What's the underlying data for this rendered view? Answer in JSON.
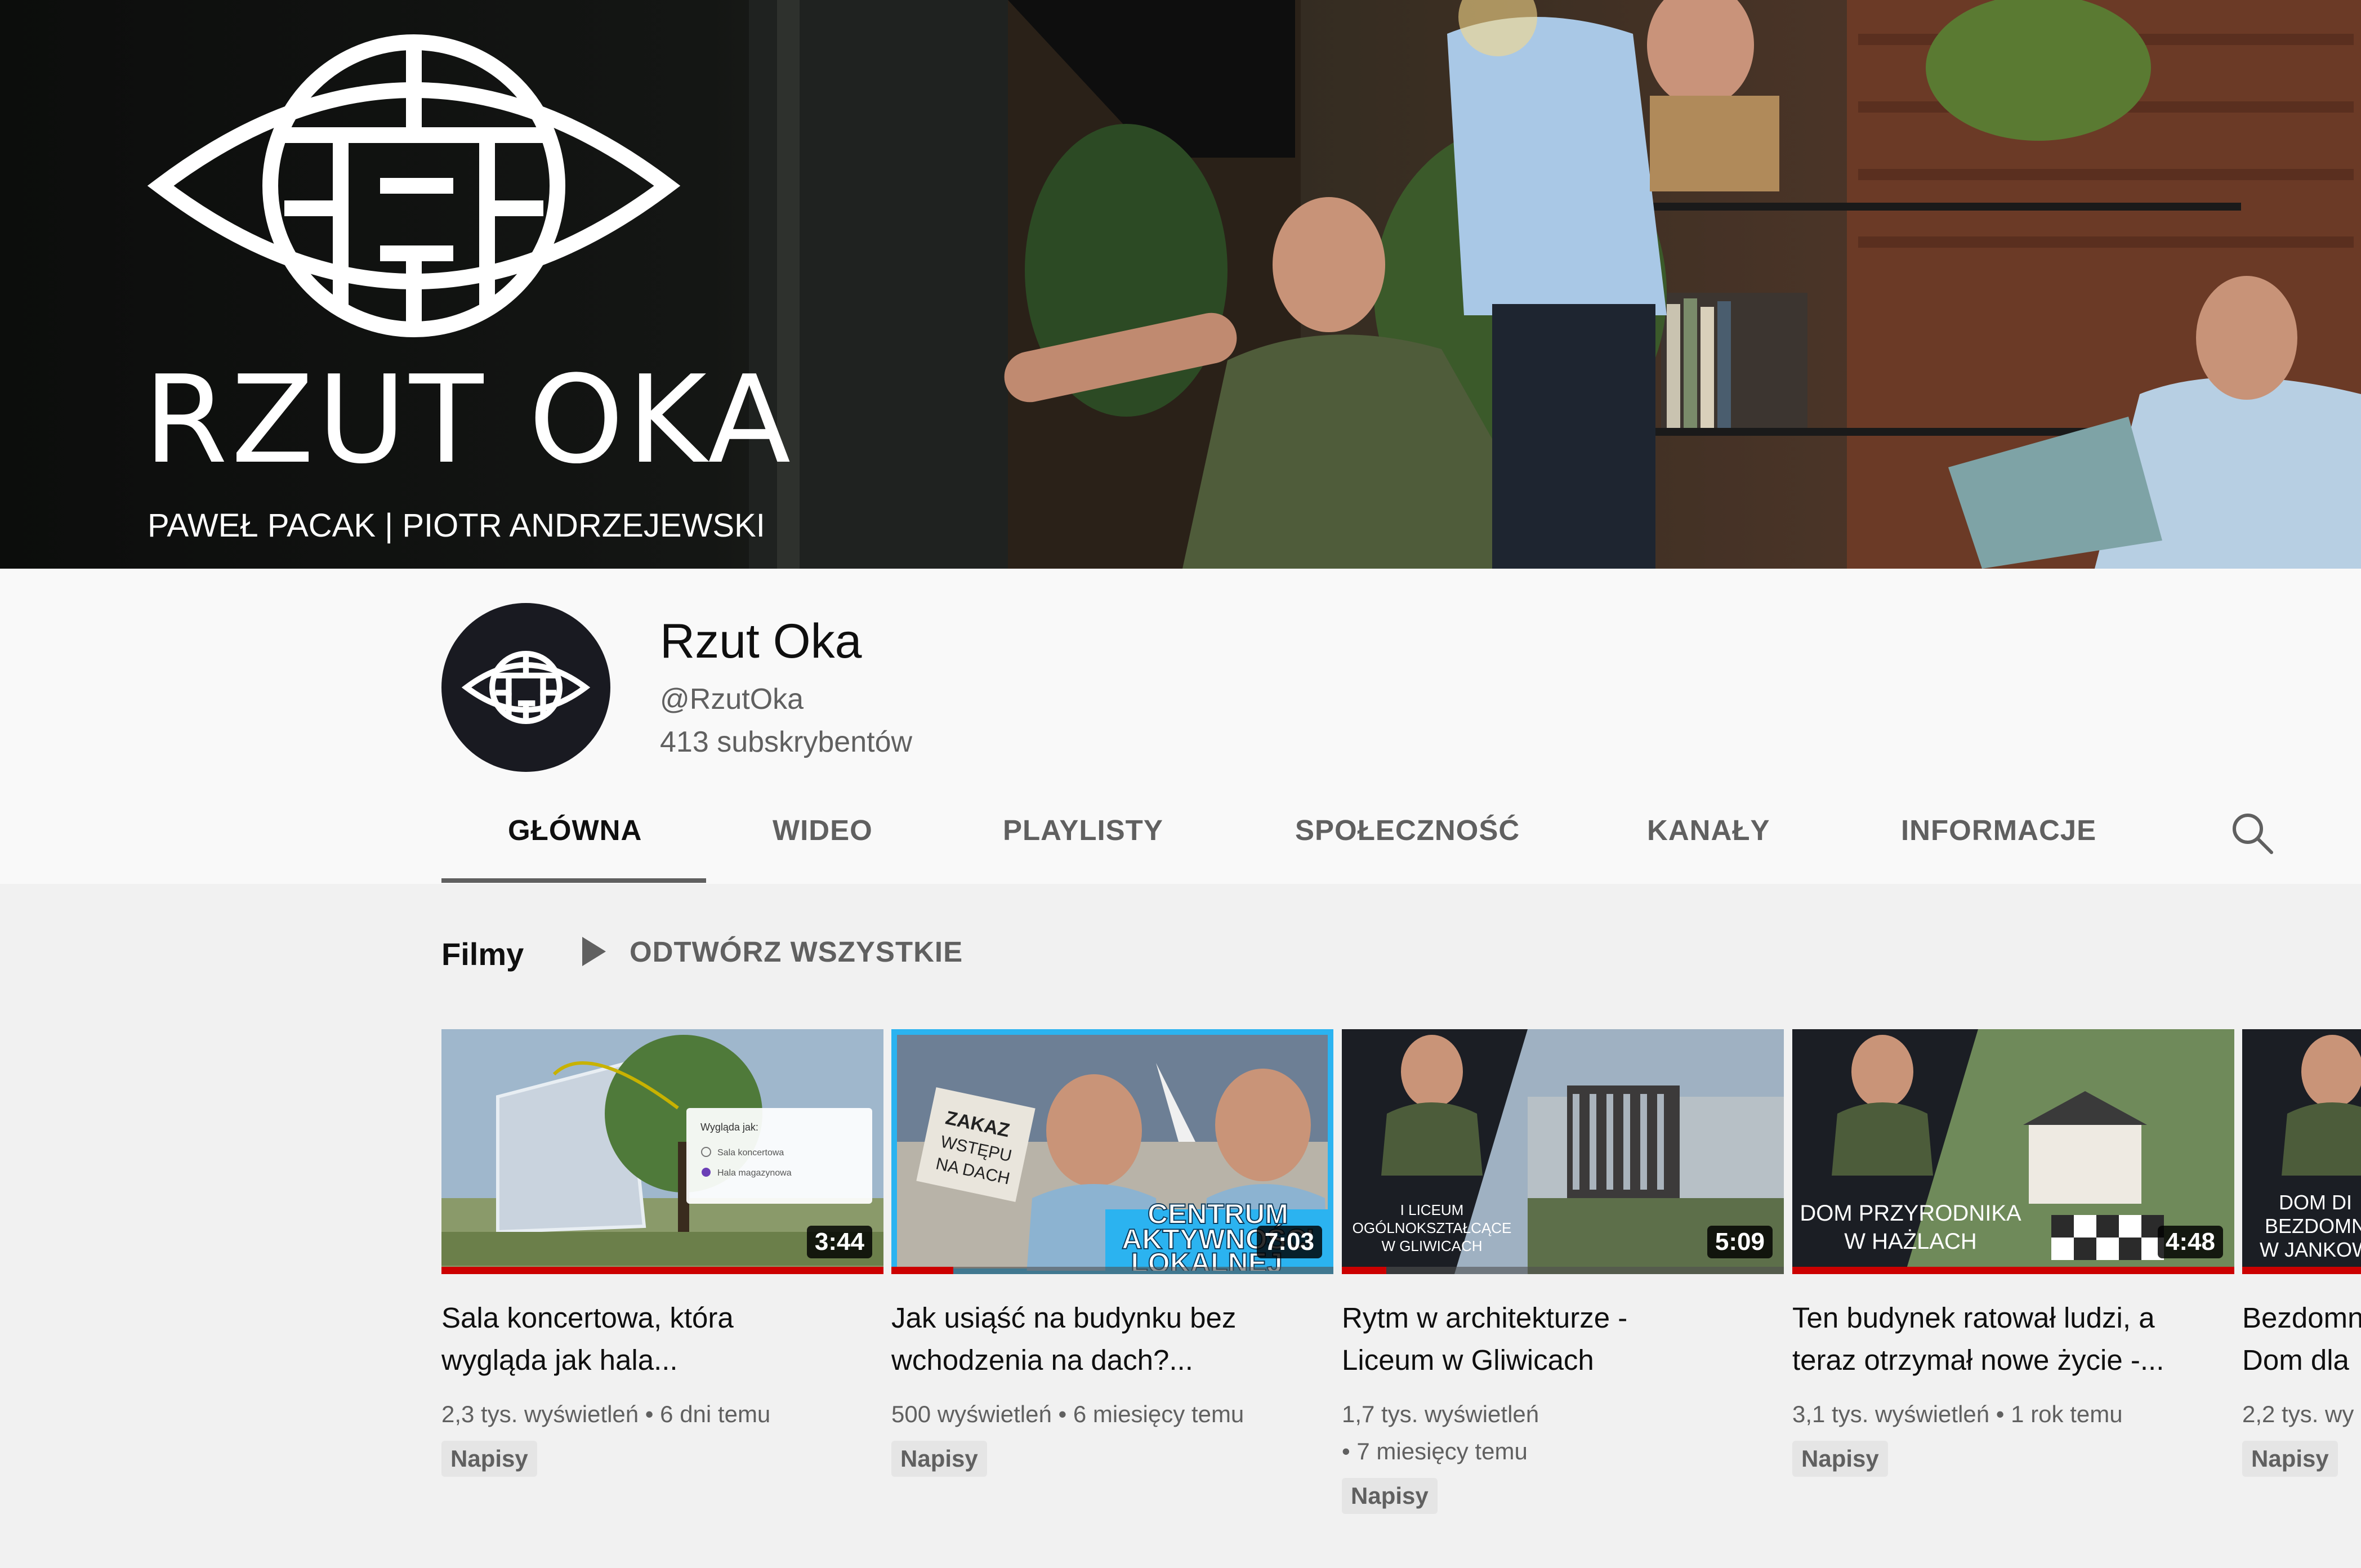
{
  "banner": {
    "title": "RZUT OKA",
    "subtitle": "PAWEŁ PACAK | PIOTR ANDRZEJEWSKI",
    "logo_icon": "eye-maze-icon"
  },
  "channel": {
    "name": "Rzut Oka",
    "handle": "@RzutOka",
    "subscribers": "413 subskrybentów",
    "avatar_icon": "eye-maze-icon"
  },
  "tabs": [
    {
      "label": "GŁÓWNA",
      "active": true
    },
    {
      "label": "WIDEO",
      "active": false
    },
    {
      "label": "PLAYLISTY",
      "active": false
    },
    {
      "label": "SPOŁECZNOŚĆ",
      "active": false
    },
    {
      "label": "KANAŁY",
      "active": false
    },
    {
      "label": "INFORMACJE",
      "active": false
    }
  ],
  "search_icon": "search-icon",
  "section": {
    "title": "Filmy",
    "play_all": "ODTWÓRZ WSZYSTKIE",
    "play_icon": "play-icon"
  },
  "videos": [
    {
      "title_line1": "Sala koncertowa, która",
      "title_line2": "wygląda jak hala...",
      "meta_line1": "2,3 tys. wyświetleń • 6 dni temu",
      "meta_line2": "",
      "duration": "3:44",
      "badge": "Napisy",
      "progress": 1.0,
      "thumb_text": [
        "Wygląda jak:",
        "Sala koncertowa",
        "Hala magazynowa"
      ]
    },
    {
      "title_line1": "Jak usiąść na budynku bez",
      "title_line2": "wchodzenia na dach?...",
      "meta_line1": "500 wyświetleń • 6 miesięcy temu",
      "meta_line2": "",
      "duration": "7:03",
      "badge": "Napisy",
      "progress": 0.14,
      "thumb_text": [
        "ZAKAZ",
        "WSTĘPU",
        "NA DACH",
        "CENTRUM",
        "AKTYWNOŚCI",
        "LOKALNEJ"
      ]
    },
    {
      "title_line1": "Rytm w architekturze -",
      "title_line2": "Liceum w Gliwicach",
      "meta_line1": "1,7 tys. wyświetleń",
      "meta_line2": "• 7 miesięcy temu",
      "duration": "5:09",
      "badge": "Napisy",
      "progress": 0.1,
      "thumb_text": [
        "I LICEUM",
        "OGÓLNOKSZTAŁCĄCE",
        "W GLIWICACH"
      ]
    },
    {
      "title_line1": "Ten budynek ratował ludzi, a",
      "title_line2": "teraz otrzymał nowe życie -...",
      "meta_line1": "3,1 tys. wyświetleń • 1 rok temu",
      "meta_line2": "",
      "duration": "4:48",
      "badge": "Napisy",
      "progress": 1.0,
      "thumb_text": [
        "DOM PRZYRODNIKA",
        "W HAŻLACH"
      ]
    },
    {
      "title_line1": "Bezdomn",
      "title_line2": "Dom dla",
      "meta_line1": "2,2 tys. wy",
      "meta_line2": "",
      "duration": "",
      "badge": "Napisy",
      "progress": 1.0,
      "thumb_text": [
        "DOM DI",
        "BEZDOMN",
        "W JANKOW"
      ]
    }
  ]
}
